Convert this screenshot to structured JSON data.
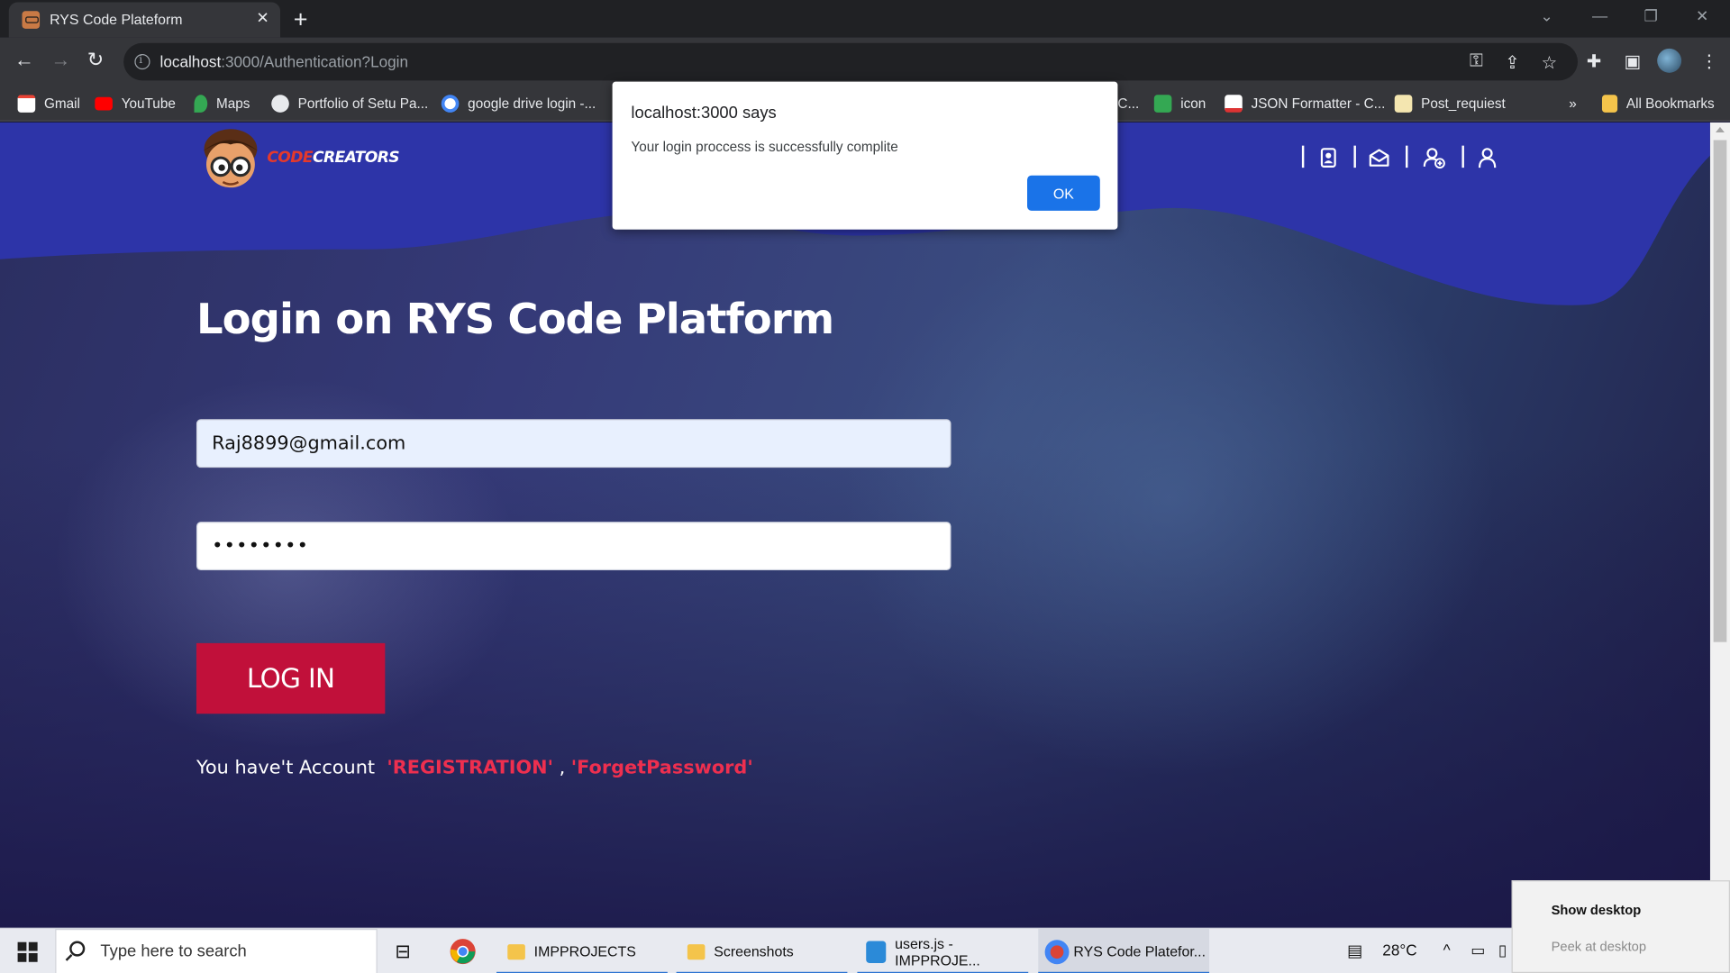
{
  "browser": {
    "tab_title": "RYS Code Plateform",
    "url_host": "localhost",
    "url_rest": ":3000/Authentication?Login",
    "bookmarks": [
      {
        "label": "Gmail"
      },
      {
        "label": "YouTube"
      },
      {
        "label": "Maps"
      },
      {
        "label": "Portfolio of Setu Pa..."
      },
      {
        "label": "google drive login -..."
      },
      {
        "label": "C..."
      },
      {
        "label": "icon"
      },
      {
        "label": "JSON Formatter - C..."
      },
      {
        "label": "Post_requiest"
      }
    ],
    "all_bookmarks": "All Bookmarks",
    "overflow": "»"
  },
  "dialog": {
    "title": "localhost:3000 says",
    "message": "Your login proccess is successfully complite",
    "ok_label": "OK"
  },
  "page": {
    "logo_part1": "CODE",
    "logo_part2": "CREATORS",
    "heading": "Login on RYS Code Platform",
    "email_value": "Raj8899@gmail.com",
    "password_mask": "••••••••",
    "login_button": "LOG IN",
    "account_text": "You have't Account",
    "registration_link": "'REGISTRATION'",
    "separator": ",",
    "forget_link": "'ForgetPassword'",
    "header_icons": [
      "contact-book-icon",
      "mail-icon",
      "add-user-icon",
      "user-icon"
    ]
  },
  "taskbar": {
    "search_placeholder": "Type here to search",
    "items": [
      {
        "label": "IMPPROJECTS"
      },
      {
        "label": "Screenshots"
      },
      {
        "label": "users.js - IMPPROJE..."
      },
      {
        "label": "RYS Code Platefor..."
      }
    ],
    "temperature": "28°C",
    "peek": {
      "show_desktop": "Show desktop",
      "peek_at_desktop": "Peek at desktop"
    }
  },
  "colors": {
    "header_band": "#2d34a8",
    "login_button": "#c1103a",
    "link": "#ee2f4f",
    "ok_button": "#1a73e8"
  }
}
